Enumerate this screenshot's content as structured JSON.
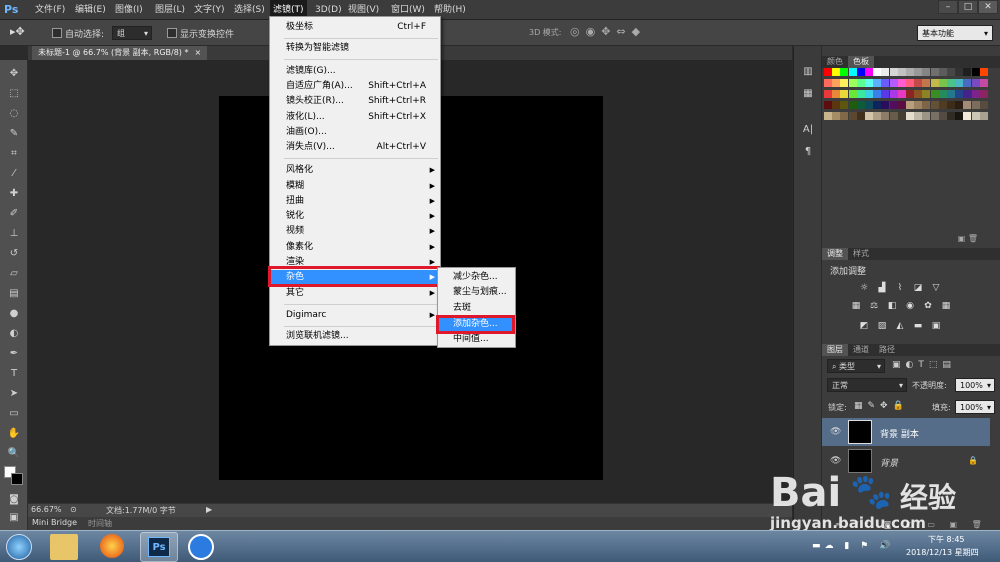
{
  "app": {
    "logo": "Ps"
  },
  "menubar": {
    "items": [
      "文件(F)",
      "编辑(E)",
      "图像(I)",
      "图层(L)",
      "文字(Y)",
      "选择(S)",
      "滤镜(T)",
      "3D(D)",
      "视图(V)",
      "窗口(W)",
      "帮助(H)"
    ],
    "active": "滤镜(T)",
    "window_buttons": [
      "–",
      "□",
      "✕"
    ]
  },
  "options": {
    "auto_select_label": "自动选择:",
    "auto_select_value": "组",
    "show_transform_label": "显示变换控件",
    "mode_3d_label": "3D 模式:",
    "workspace": "基本功能"
  },
  "document": {
    "tab_title": "未标题-1 @ 66.7% (背景 副本, RGB/8) *",
    "zoom": "66.67%",
    "doc_info": "文档:1.77M/0 字节"
  },
  "bottom_tabs": [
    "Mini Bridge",
    "时间轴"
  ],
  "filter_menu": {
    "items": [
      {
        "label": "极坐标",
        "shortcut": "Ctrl+F"
      },
      {
        "label": "转换为智能滤镜"
      },
      {
        "label": "滤镜库(G)..."
      },
      {
        "label": "自适应广角(A)...",
        "shortcut": "Shift+Ctrl+A"
      },
      {
        "label": "镜头校正(R)...",
        "shortcut": "Shift+Ctrl+R"
      },
      {
        "label": "液化(L)...",
        "shortcut": "Shift+Ctrl+X"
      },
      {
        "label": "油画(O)..."
      },
      {
        "label": "消失点(V)...",
        "shortcut": "Alt+Ctrl+V"
      },
      {
        "label": "风格化"
      },
      {
        "label": "模糊"
      },
      {
        "label": "扭曲"
      },
      {
        "label": "锐化"
      },
      {
        "label": "视频"
      },
      {
        "label": "像素化"
      },
      {
        "label": "渲染"
      },
      {
        "label": "杂色"
      },
      {
        "label": "其它"
      },
      {
        "label": "Digimarc"
      },
      {
        "label": "浏览联机滤镜..."
      }
    ],
    "highlighted": "杂色"
  },
  "noise_submenu": {
    "items": [
      "减少杂色...",
      "蒙尘与划痕...",
      "去斑",
      "添加杂色...",
      "中间值..."
    ],
    "highlighted": "添加杂色..."
  },
  "panels": {
    "color_tabs": [
      "颜色",
      "色板"
    ],
    "adjust_tabs": [
      "调整",
      "样式"
    ],
    "adjust_title": "添加调整",
    "layers_tabs": [
      "图层",
      "通道",
      "路径"
    ],
    "layer_filter": "类型",
    "blend_mode": "正常",
    "opacity_label": "不透明度:",
    "opacity_value": "100%",
    "lock_label": "锁定:",
    "fill_label": "填充:",
    "fill_value": "100%",
    "layers": [
      {
        "name": "背景 副本",
        "selected": true
      },
      {
        "name": "背景",
        "selected": false
      }
    ]
  },
  "taskbar": {
    "time": "下午 8:45",
    "date": "2018/12/13 星期四"
  },
  "watermark": {
    "brand": "Bai",
    "brand_cn": "经验",
    "url": "jingyan.baidu.com"
  },
  "colors": {
    "highlight": "#3390ff",
    "red_box": "#e0182c",
    "swatches": [
      [
        "#ff0000",
        "#ffff00",
        "#00ff00",
        "#00ffff",
        "#0000ff",
        "#ff00ff",
        "#ffffff",
        "#ebebeb",
        "#d6d6d6",
        "#c2c2c2",
        "#adadad",
        "#999999",
        "#858585",
        "#707070",
        "#5c5c5c",
        "#474747",
        "#333333",
        "#1f1f1f",
        "#000000",
        "#ff4500"
      ],
      [
        "#ff6a5c",
        "#ffa05c",
        "#fff15c",
        "#9bff5c",
        "#5cff90",
        "#5cfff0",
        "#5cb0ff",
        "#6a5cff",
        "#b45cff",
        "#ff5cd1",
        "#ff5c82",
        "#c44a4a",
        "#c4774a",
        "#c4b84a",
        "#7ac44a",
        "#4ac489",
        "#4ab5c4",
        "#4a6bc4",
        "#7a4ac4",
        "#c44aa4"
      ],
      [
        "#e83a3a",
        "#e8883a",
        "#e8d83a",
        "#6ae83a",
        "#3ae8a0",
        "#3ad0e8",
        "#3a80e8",
        "#5a3ae8",
        "#a83ae8",
        "#e83ac0",
        "#8c2424",
        "#8c5424",
        "#8c8424",
        "#3c8c24",
        "#248c5c",
        "#24788c",
        "#24448c",
        "#44248c",
        "#7c248c",
        "#8c2464"
      ],
      [
        "#5c0e0e",
        "#5c360e",
        "#5c560e",
        "#1e5c0e",
        "#0e5c3c",
        "#0e4c5c",
        "#0e245c",
        "#2a0e5c",
        "#500e5c",
        "#5c0e40",
        "#b89e7c",
        "#9c8260",
        "#806448",
        "#645034",
        "#503c24",
        "#3c2c18",
        "#2c1e10",
        "#a08c78",
        "#7c6c5c",
        "#584c40"
      ],
      [
        "#c8b48c",
        "#a48c64",
        "#806848",
        "#5c4830",
        "#40301c",
        "#d4c4a8",
        "#b0a088",
        "#8c7c68",
        "#685c4c",
        "#443c30",
        "#e4dccc",
        "#c0b8a8",
        "#9c9484",
        "#787064",
        "#544c44",
        "#302c24",
        "#181410",
        "#f0e8d8",
        "#ccc4b4",
        "#a8a090"
      ]
    ]
  }
}
